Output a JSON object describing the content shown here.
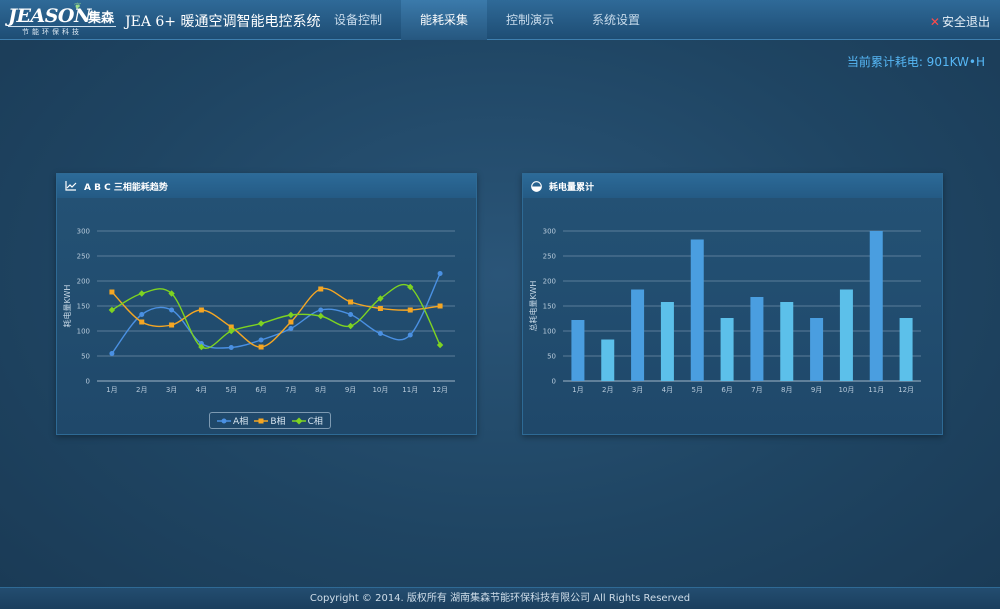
{
  "header": {
    "logo_text": "JEASON",
    "logo_cn": "集森",
    "logo_sub": "节能环保科技",
    "app_title": "JEA 6+ 暖通空调智能电控系统",
    "nav": [
      {
        "label": "设备控制",
        "active": false
      },
      {
        "label": "能耗采集",
        "active": true
      },
      {
        "label": "控制演示",
        "active": false
      },
      {
        "label": "系统设置",
        "active": false
      }
    ],
    "logout": "安全退出"
  },
  "summary": {
    "total": "当前累计耗电: 901KW•H"
  },
  "panels": {
    "trend_title": "A B C 三相能耗趋势",
    "cumulative_title": "耗电量累计"
  },
  "chart_data": [
    {
      "type": "line",
      "title": "A B C 三相能耗趋势",
      "ylabel": "耗电量KWH",
      "ylim": [
        0,
        300
      ],
      "yticks": [
        0,
        50,
        100,
        150,
        200,
        250,
        300
      ],
      "categories": [
        "1月",
        "2月",
        "3月",
        "4月",
        "5月",
        "6月",
        "7月",
        "8月",
        "9月",
        "10月",
        "11月",
        "12月"
      ],
      "series": [
        {
          "name": "A相",
          "color": "#4a90e2",
          "marker": "circle",
          "values": [
            55,
            133,
            142,
            75,
            67,
            82,
            105,
            142,
            133,
            95,
            92,
            215
          ]
        },
        {
          "name": "B相",
          "color": "#f5a623",
          "marker": "square",
          "values": [
            178,
            118,
            112,
            142,
            108,
            68,
            118,
            184,
            158,
            145,
            142,
            150
          ]
        },
        {
          "name": "C相",
          "color": "#7ed321",
          "marker": "diamond",
          "values": [
            142,
            175,
            175,
            68,
            100,
            115,
            132,
            130,
            110,
            165,
            188,
            72
          ]
        }
      ],
      "legend": "bottom-center"
    },
    {
      "type": "bar",
      "title": "耗电量累计",
      "ylabel": "总耗电量KWH",
      "ylim": [
        0,
        300
      ],
      "yticks": [
        0,
        50,
        100,
        150,
        200,
        250,
        300
      ],
      "categories": [
        "1月",
        "2月",
        "3月",
        "4月",
        "5月",
        "6月",
        "7月",
        "8月",
        "9月",
        "10月",
        "11月",
        "12月"
      ],
      "values": [
        122,
        83,
        183,
        158,
        283,
        126,
        168,
        158,
        126,
        183,
        300,
        126
      ],
      "colors": [
        "#4a9ee0",
        "#5cc0ea"
      ]
    }
  ],
  "footer": {
    "text": "Copyright © 2014. 版权所有 湖南集森节能环保科技有限公司 All Rights Reserved"
  }
}
